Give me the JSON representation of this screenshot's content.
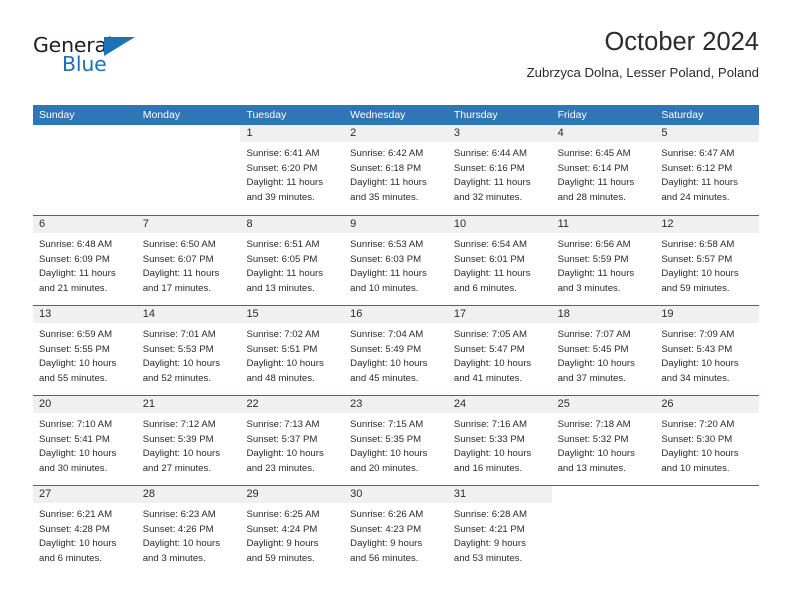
{
  "brand": {
    "name_part1": "General",
    "name_part2": "Blue",
    "accent_color": "#1b72b8"
  },
  "header": {
    "title": "October 2024",
    "subtitle": "Zubrzyca Dolna, Lesser Poland, Poland"
  },
  "theme": {
    "header_blue": "#3075b5",
    "week_rule_blue": "#2f6ca8",
    "daynum_strip_gray": "#f0f0f0",
    "text_color": "#2b2b2b"
  },
  "weekdays": [
    "Sunday",
    "Monday",
    "Tuesday",
    "Wednesday",
    "Thursday",
    "Friday",
    "Saturday"
  ],
  "weeks": [
    [
      {
        "empty": true
      },
      {
        "empty": true
      },
      {
        "empty": false,
        "day": "1",
        "sunrise": "Sunrise: 6:41 AM",
        "sunset": "Sunset: 6:20 PM",
        "daylight_line1": "Daylight: 11 hours",
        "daylight_line2": "and 39 minutes."
      },
      {
        "empty": false,
        "day": "2",
        "sunrise": "Sunrise: 6:42 AM",
        "sunset": "Sunset: 6:18 PM",
        "daylight_line1": "Daylight: 11 hours",
        "daylight_line2": "and 35 minutes."
      },
      {
        "empty": false,
        "day": "3",
        "sunrise": "Sunrise: 6:44 AM",
        "sunset": "Sunset: 6:16 PM",
        "daylight_line1": "Daylight: 11 hours",
        "daylight_line2": "and 32 minutes."
      },
      {
        "empty": false,
        "day": "4",
        "sunrise": "Sunrise: 6:45 AM",
        "sunset": "Sunset: 6:14 PM",
        "daylight_line1": "Daylight: 11 hours",
        "daylight_line2": "and 28 minutes."
      },
      {
        "empty": false,
        "day": "5",
        "sunrise": "Sunrise: 6:47 AM",
        "sunset": "Sunset: 6:12 PM",
        "daylight_line1": "Daylight: 11 hours",
        "daylight_line2": "and 24 minutes."
      }
    ],
    [
      {
        "empty": false,
        "day": "6",
        "sunrise": "Sunrise: 6:48 AM",
        "sunset": "Sunset: 6:09 PM",
        "daylight_line1": "Daylight: 11 hours",
        "daylight_line2": "and 21 minutes."
      },
      {
        "empty": false,
        "day": "7",
        "sunrise": "Sunrise: 6:50 AM",
        "sunset": "Sunset: 6:07 PM",
        "daylight_line1": "Daylight: 11 hours",
        "daylight_line2": "and 17 minutes."
      },
      {
        "empty": false,
        "day": "8",
        "sunrise": "Sunrise: 6:51 AM",
        "sunset": "Sunset: 6:05 PM",
        "daylight_line1": "Daylight: 11 hours",
        "daylight_line2": "and 13 minutes."
      },
      {
        "empty": false,
        "day": "9",
        "sunrise": "Sunrise: 6:53 AM",
        "sunset": "Sunset: 6:03 PM",
        "daylight_line1": "Daylight: 11 hours",
        "daylight_line2": "and 10 minutes."
      },
      {
        "empty": false,
        "day": "10",
        "sunrise": "Sunrise: 6:54 AM",
        "sunset": "Sunset: 6:01 PM",
        "daylight_line1": "Daylight: 11 hours",
        "daylight_line2": "and 6 minutes."
      },
      {
        "empty": false,
        "day": "11",
        "sunrise": "Sunrise: 6:56 AM",
        "sunset": "Sunset: 5:59 PM",
        "daylight_line1": "Daylight: 11 hours",
        "daylight_line2": "and 3 minutes."
      },
      {
        "empty": false,
        "day": "12",
        "sunrise": "Sunrise: 6:58 AM",
        "sunset": "Sunset: 5:57 PM",
        "daylight_line1": "Daylight: 10 hours",
        "daylight_line2": "and 59 minutes."
      }
    ],
    [
      {
        "empty": false,
        "day": "13",
        "sunrise": "Sunrise: 6:59 AM",
        "sunset": "Sunset: 5:55 PM",
        "daylight_line1": "Daylight: 10 hours",
        "daylight_line2": "and 55 minutes."
      },
      {
        "empty": false,
        "day": "14",
        "sunrise": "Sunrise: 7:01 AM",
        "sunset": "Sunset: 5:53 PM",
        "daylight_line1": "Daylight: 10 hours",
        "daylight_line2": "and 52 minutes."
      },
      {
        "empty": false,
        "day": "15",
        "sunrise": "Sunrise: 7:02 AM",
        "sunset": "Sunset: 5:51 PM",
        "daylight_line1": "Daylight: 10 hours",
        "daylight_line2": "and 48 minutes."
      },
      {
        "empty": false,
        "day": "16",
        "sunrise": "Sunrise: 7:04 AM",
        "sunset": "Sunset: 5:49 PM",
        "daylight_line1": "Daylight: 10 hours",
        "daylight_line2": "and 45 minutes."
      },
      {
        "empty": false,
        "day": "17",
        "sunrise": "Sunrise: 7:05 AM",
        "sunset": "Sunset: 5:47 PM",
        "daylight_line1": "Daylight: 10 hours",
        "daylight_line2": "and 41 minutes."
      },
      {
        "empty": false,
        "day": "18",
        "sunrise": "Sunrise: 7:07 AM",
        "sunset": "Sunset: 5:45 PM",
        "daylight_line1": "Daylight: 10 hours",
        "daylight_line2": "and 37 minutes."
      },
      {
        "empty": false,
        "day": "19",
        "sunrise": "Sunrise: 7:09 AM",
        "sunset": "Sunset: 5:43 PM",
        "daylight_line1": "Daylight: 10 hours",
        "daylight_line2": "and 34 minutes."
      }
    ],
    [
      {
        "empty": false,
        "day": "20",
        "sunrise": "Sunrise: 7:10 AM",
        "sunset": "Sunset: 5:41 PM",
        "daylight_line1": "Daylight: 10 hours",
        "daylight_line2": "and 30 minutes."
      },
      {
        "empty": false,
        "day": "21",
        "sunrise": "Sunrise: 7:12 AM",
        "sunset": "Sunset: 5:39 PM",
        "daylight_line1": "Daylight: 10 hours",
        "daylight_line2": "and 27 minutes."
      },
      {
        "empty": false,
        "day": "22",
        "sunrise": "Sunrise: 7:13 AM",
        "sunset": "Sunset: 5:37 PM",
        "daylight_line1": "Daylight: 10 hours",
        "daylight_line2": "and 23 minutes."
      },
      {
        "empty": false,
        "day": "23",
        "sunrise": "Sunrise: 7:15 AM",
        "sunset": "Sunset: 5:35 PM",
        "daylight_line1": "Daylight: 10 hours",
        "daylight_line2": "and 20 minutes."
      },
      {
        "empty": false,
        "day": "24",
        "sunrise": "Sunrise: 7:16 AM",
        "sunset": "Sunset: 5:33 PM",
        "daylight_line1": "Daylight: 10 hours",
        "daylight_line2": "and 16 minutes."
      },
      {
        "empty": false,
        "day": "25",
        "sunrise": "Sunrise: 7:18 AM",
        "sunset": "Sunset: 5:32 PM",
        "daylight_line1": "Daylight: 10 hours",
        "daylight_line2": "and 13 minutes."
      },
      {
        "empty": false,
        "day": "26",
        "sunrise": "Sunrise: 7:20 AM",
        "sunset": "Sunset: 5:30 PM",
        "daylight_line1": "Daylight: 10 hours",
        "daylight_line2": "and 10 minutes."
      }
    ],
    [
      {
        "empty": false,
        "day": "27",
        "sunrise": "Sunrise: 6:21 AM",
        "sunset": "Sunset: 4:28 PM",
        "daylight_line1": "Daylight: 10 hours",
        "daylight_line2": "and 6 minutes."
      },
      {
        "empty": false,
        "day": "28",
        "sunrise": "Sunrise: 6:23 AM",
        "sunset": "Sunset: 4:26 PM",
        "daylight_line1": "Daylight: 10 hours",
        "daylight_line2": "and 3 minutes."
      },
      {
        "empty": false,
        "day": "29",
        "sunrise": "Sunrise: 6:25 AM",
        "sunset": "Sunset: 4:24 PM",
        "daylight_line1": "Daylight: 9 hours",
        "daylight_line2": "and 59 minutes."
      },
      {
        "empty": false,
        "day": "30",
        "sunrise": "Sunrise: 6:26 AM",
        "sunset": "Sunset: 4:23 PM",
        "daylight_line1": "Daylight: 9 hours",
        "daylight_line2": "and 56 minutes."
      },
      {
        "empty": false,
        "day": "31",
        "sunrise": "Sunrise: 6:28 AM",
        "sunset": "Sunset: 4:21 PM",
        "daylight_line1": "Daylight: 9 hours",
        "daylight_line2": "and 53 minutes."
      },
      {
        "empty": true
      },
      {
        "empty": true
      }
    ]
  ]
}
